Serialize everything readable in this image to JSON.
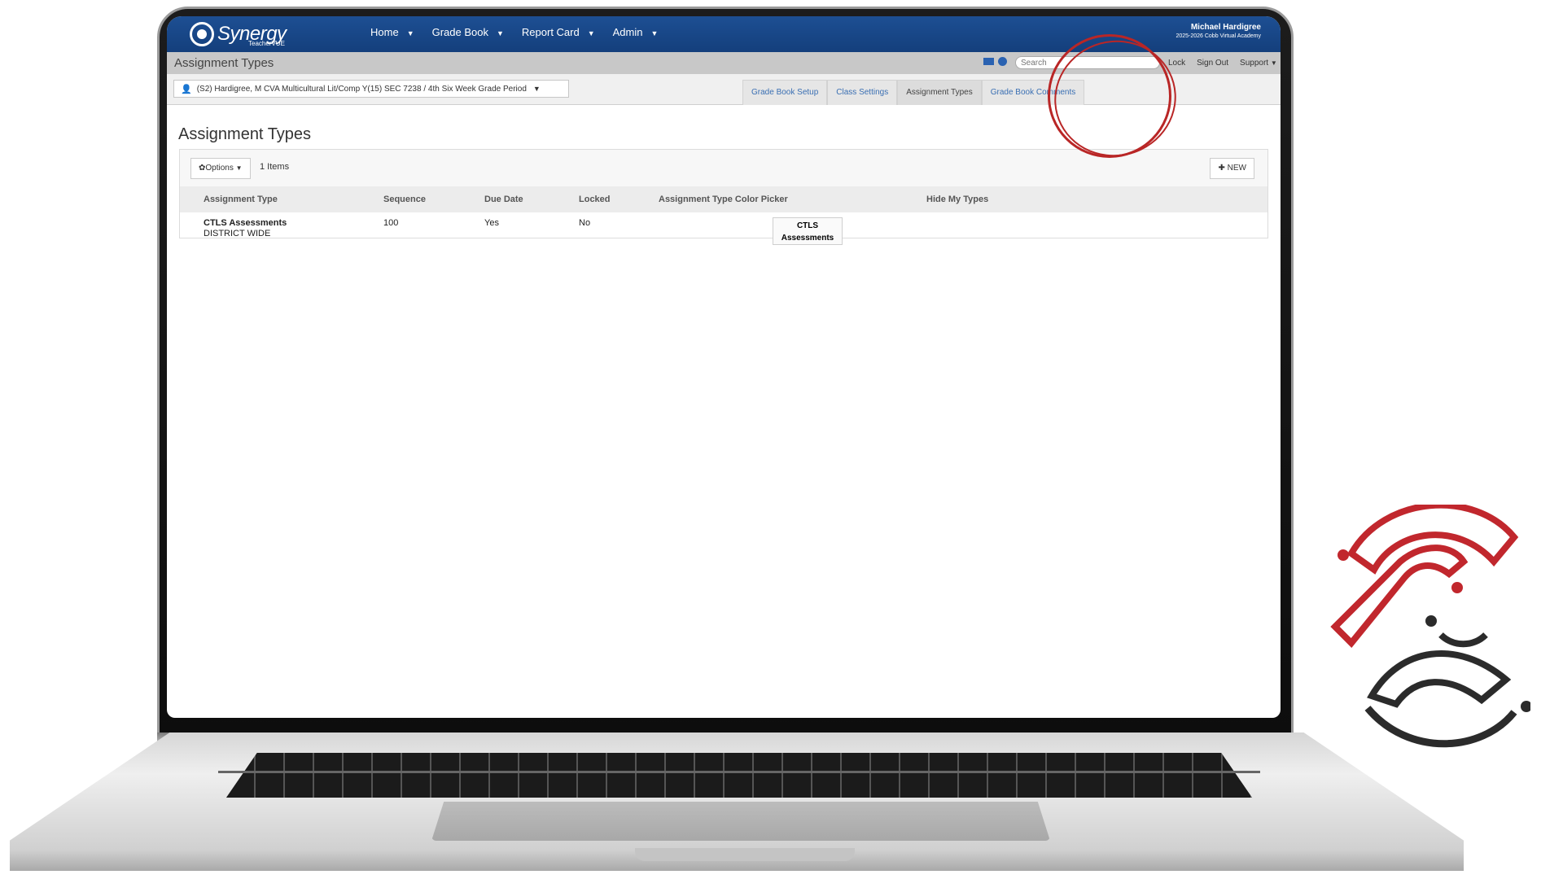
{
  "app": {
    "logo": "Synergy",
    "logo_sub": "TeacherVUE",
    "nav": [
      "Home",
      "Grade Book",
      "Report Card",
      "Admin"
    ],
    "user_name": "Michael Hardigree",
    "user_school": "2025-2026 Cobb Virtual Academy"
  },
  "subbar": {
    "page_title": "Assignment Types",
    "search_placeholder": "Search",
    "utils": [
      "Lock",
      "Sign Out",
      "Support"
    ]
  },
  "controls": {
    "class_selector": "(S2) Hardigree, M CVA Multicultural Lit/Comp Y(15) SEC 7238 / 4th Six Week Grade Period",
    "tabs": [
      "Grade Book Setup",
      "Class Settings",
      "Assignment Types",
      "Grade Book Comments"
    ],
    "active_tab": "Assignment Types"
  },
  "content": {
    "title": "Assignment Types",
    "options_label": "Options",
    "items_count": "1 Items",
    "new_label": "NEW",
    "columns": [
      "Assignment Type",
      "Sequence",
      "Due Date",
      "Locked",
      "Assignment Type Color Picker",
      "Hide My Types"
    ],
    "rows": [
      {
        "assignment_type": "CTLS Assessments",
        "scope": "DISTRICT WIDE",
        "sequence": "100",
        "due_date": "Yes",
        "locked": "No",
        "color_label_1": "CTLS",
        "color_label_2": "Assessments"
      }
    ]
  },
  "colors": {
    "topbar": "#1d4f93",
    "annotation": "#b92626",
    "brand_red": "#c1272d",
    "brand_dark": "#2b2b2b"
  },
  "icons": [
    "mail-icon",
    "globe-icon",
    "person-icon",
    "gear-icon",
    "plus-icon",
    "caret-down-icon"
  ]
}
